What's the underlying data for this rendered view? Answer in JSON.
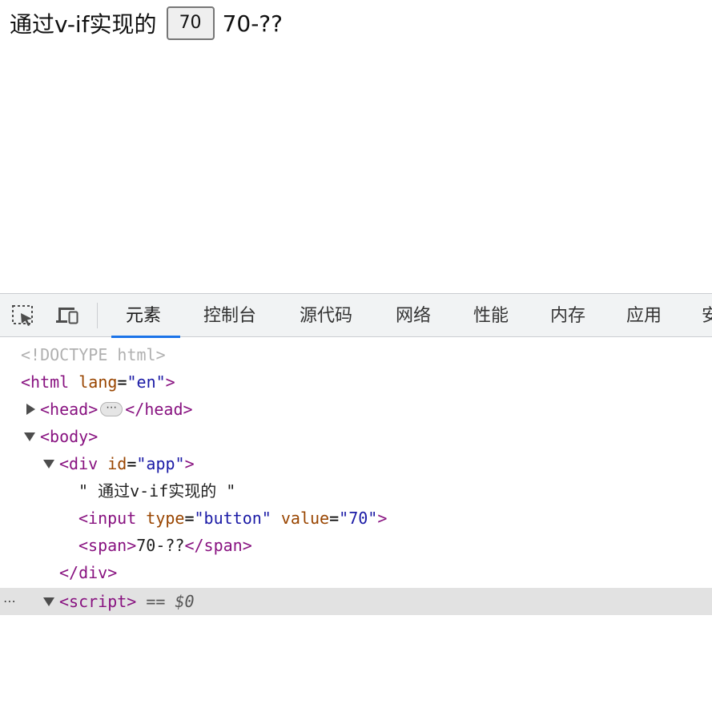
{
  "page": {
    "text": "通过v-if实现的",
    "button_value": "70",
    "span_text": "70-??"
  },
  "devtools": {
    "toolbar": {
      "inspect_icon": "element-picker-icon",
      "device_icon": "device-toolbar-icon",
      "tabs": [
        "元素",
        "控制台",
        "源代码",
        "网络",
        "性能",
        "内存",
        "应用",
        "安"
      ],
      "active_tab": "元素"
    },
    "tree": {
      "doctype": "<!DOCTYPE html>",
      "html_open": "<html",
      "html_lang_attr": "lang",
      "html_lang_val": "\"en\"",
      "html_close": ">",
      "head_open": "<head>",
      "head_ellipsis": "⋯",
      "head_close": "</head>",
      "body_open": "<body>",
      "div_open": "<div",
      "div_id_attr": "id",
      "div_id_val": "\"app\"",
      "div_gt": ">",
      "text_node": "\" 通过v-if实现的 \"",
      "input_open": "<input",
      "input_type_attr": "type",
      "input_type_val": "\"button\"",
      "input_value_attr": "value",
      "input_value_val": "\"70\"",
      "input_gt": ">",
      "span_open": "<span>",
      "span_text": "70-??",
      "span_close": "</span>",
      "div_close": "</div>",
      "script_open": "<script>",
      "selected_marker": "== $0",
      "gutter": "⋯"
    }
  },
  "colors": {
    "tag": "#881280",
    "attr_name": "#994500",
    "attr_value": "#1a1aa6",
    "active_tab_underline": "#1a73e8",
    "selected_row": "#e2e2e2"
  }
}
